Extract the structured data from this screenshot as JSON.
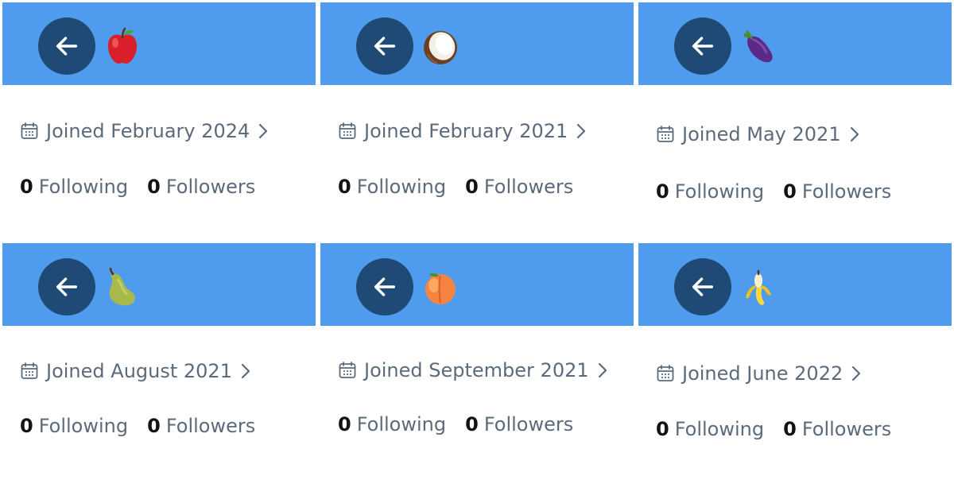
{
  "cards": [
    {
      "emoji_icon": "red-apple-icon",
      "joined": "Joined February 2024",
      "following_count": "0",
      "following_label": "Following",
      "followers_count": "0",
      "followers_label": "Followers"
    },
    {
      "emoji_icon": "coconut-icon",
      "joined": "Joined February 2021",
      "following_count": "0",
      "following_label": "Following",
      "followers_count": "0",
      "followers_label": "Followers"
    },
    {
      "emoji_icon": "eggplant-icon",
      "joined": "Joined May 2021",
      "following_count": "0",
      "following_label": "Following",
      "followers_count": "0",
      "followers_label": "Followers"
    },
    {
      "emoji_icon": "pear-icon",
      "joined": "Joined August 2021",
      "following_count": "0",
      "following_label": "Following",
      "followers_count": "0",
      "followers_label": "Followers"
    },
    {
      "emoji_icon": "peach-icon",
      "joined": "Joined September 2021",
      "following_count": "0",
      "following_label": "Following",
      "followers_count": "0",
      "followers_label": "Followers"
    },
    {
      "emoji_icon": "banana-icon",
      "joined": "Joined June 2022",
      "following_count": "0",
      "following_label": "Following",
      "followers_count": "0",
      "followers_label": "Followers"
    }
  ],
  "colors": {
    "banner": "#4f9cee",
    "back_button": "#1e4a75",
    "muted_text": "#5b6b7c",
    "count_text": "#0f1419"
  }
}
